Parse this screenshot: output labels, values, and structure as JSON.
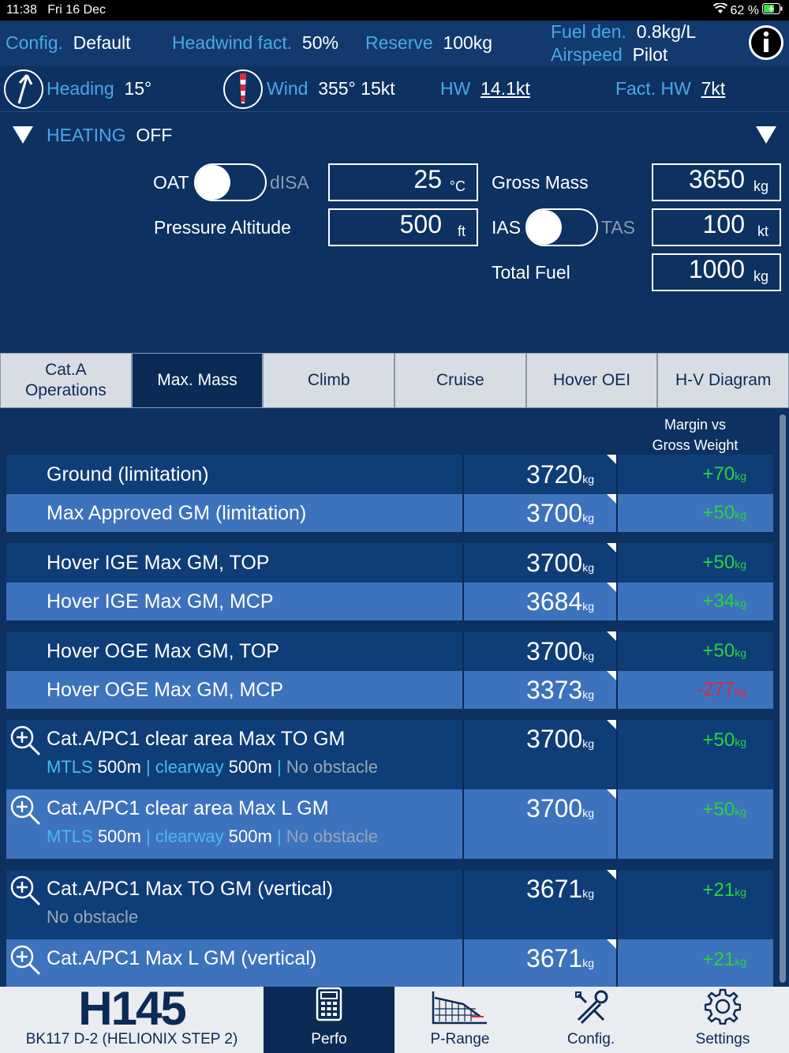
{
  "status": {
    "time": "11:38",
    "date": "Fri 16 Dec",
    "battery": "62 %"
  },
  "topbar": {
    "config_label": "Config.",
    "config_value": "Default",
    "headwind_label": "Headwind fact.",
    "headwind_value": "50%",
    "reserve_label": "Reserve",
    "reserve_value": "100kg",
    "fuel_den_label": "Fuel den.",
    "fuel_den_value": "0.8kg/L",
    "airspeed_label": "Airspeed",
    "airspeed_value": "Pilot"
  },
  "wind_row": {
    "heading_label": "Heading",
    "heading_value": "15°",
    "wind_label": "Wind",
    "wind_value": "355° 15kt",
    "hw_label": "HW",
    "hw_value": "14.1kt",
    "fact_hw_label": "Fact. HW",
    "fact_hw_value": "7kt"
  },
  "heating": {
    "label": "HEATING",
    "value": "OFF"
  },
  "inputs": {
    "oat_label": "OAT",
    "disa_label": "dISA",
    "temp_value": "25",
    "temp_unit": "°C",
    "pressure_alt_label": "Pressure Altitude",
    "pressure_alt_value": "500",
    "pressure_alt_unit": "ft",
    "gross_mass_label": "Gross Mass",
    "gross_mass_value": "3650",
    "gross_mass_unit": "kg",
    "ias_label": "IAS",
    "tas_label": "TAS",
    "speed_value": "100",
    "speed_unit": "kt",
    "total_fuel_label": "Total Fuel",
    "total_fuel_value": "1000",
    "total_fuel_unit": "kg"
  },
  "tabs": [
    {
      "label": "Cat.A\nOperations"
    },
    {
      "label": "Max. Mass"
    },
    {
      "label": "Climb"
    },
    {
      "label": "Cruise"
    },
    {
      "label": "Hover OEI"
    },
    {
      "label": "H-V Diagram"
    }
  ],
  "margin_header": "Margin vs\nGross Weight",
  "unit_kg": "kg",
  "rows": [
    {
      "label": "Ground (limitation)",
      "value": "3720",
      "margin": "+70"
    },
    {
      "label": "Max Approved GM (limitation)",
      "value": "3700",
      "margin": "+50"
    },
    {
      "label": "Hover IGE Max GM, TOP",
      "value": "3700",
      "margin": "+50"
    },
    {
      "label": "Hover IGE Max GM, MCP",
      "value": "3684",
      "margin": "+34"
    },
    {
      "label": "Hover OGE Max GM, TOP",
      "value": "3700",
      "margin": "+50"
    },
    {
      "label": "Hover OGE Max GM, MCP",
      "value": "3373",
      "margin": "-277"
    },
    {
      "label": "Cat.A/PC1 clear area Max TO GM",
      "value": "3700",
      "margin": "+50",
      "sub": {
        "mtls_label": "MTLS",
        "mtls_value": "500m",
        "sep1": "|",
        "clearway_label": "clearway",
        "clearway_value": "500m",
        "sep2": "|",
        "obstacle": "No obstacle"
      }
    },
    {
      "label": "Cat.A/PC1 clear area Max L GM",
      "value": "3700",
      "margin": "+50",
      "sub": {
        "mtls_label": "MTLS",
        "mtls_value": "500m",
        "sep1": "|",
        "clearway_label": "clearway",
        "clearway_value": "500m",
        "sep2": "|",
        "obstacle": "No obstacle"
      }
    },
    {
      "label": "Cat.A/PC1 Max TO GM (vertical)",
      "value": "3671",
      "margin": "+21",
      "sub_text": "No obstacle"
    },
    {
      "label": "Cat.A/PC1 Max L GM (vertical)",
      "value": "3671",
      "margin": "+21"
    }
  ],
  "bottom": {
    "logo": "H145",
    "model": "BK117 D-2 (HELIONIX STEP 2)",
    "perfo": "Perfo",
    "prange": "P-Range",
    "config": "Config.",
    "settings": "Settings"
  }
}
